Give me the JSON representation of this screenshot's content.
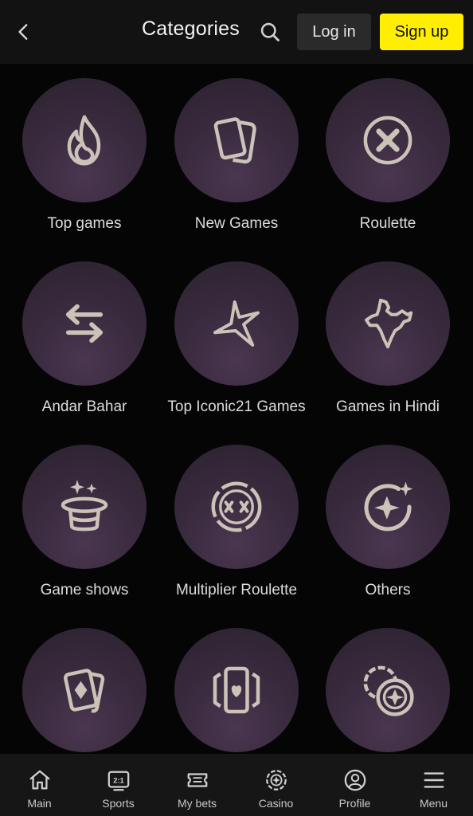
{
  "header": {
    "title": "Categories",
    "login_label": "Log in",
    "signup_label": "Sign up",
    "back_icon": "chevron-left-icon",
    "search_icon": "search-icon"
  },
  "colors": {
    "accent": "#ffee00",
    "circle_bg": "#3a2b3f",
    "icon": "#cbc3b7"
  },
  "categories": [
    {
      "label": "Top games",
      "icon": "flame-icon"
    },
    {
      "label": "New Games",
      "icon": "cards-icon"
    },
    {
      "label": "Roulette",
      "icon": "roulette-icon"
    },
    {
      "label": "Andar Bahar",
      "icon": "swap-arrows-icon"
    },
    {
      "label": "Top Iconic21 Games",
      "icon": "star-burst-icon"
    },
    {
      "label": "Games in Hindi",
      "icon": "india-map-icon"
    },
    {
      "label": "Game shows",
      "icon": "magic-hat-icon"
    },
    {
      "label": "Multiplier Roulette",
      "icon": "multiplier-wheel-icon"
    },
    {
      "label": "Others",
      "icon": "sparkle-circle-icon"
    },
    {
      "label": "",
      "icon": "diamond-cards-icon"
    },
    {
      "label": "",
      "icon": "heart-card-icon"
    },
    {
      "label": "",
      "icon": "chips-icon"
    }
  ],
  "bottom_nav": [
    {
      "label": "Main",
      "icon": "home-icon"
    },
    {
      "label": "Sports",
      "icon": "scoreboard-icon",
      "badge": "2:1"
    },
    {
      "label": "My bets",
      "icon": "ticket-icon"
    },
    {
      "label": "Casino",
      "icon": "casino-chip-icon"
    },
    {
      "label": "Profile",
      "icon": "profile-icon"
    },
    {
      "label": "Menu",
      "icon": "hamburger-icon"
    }
  ]
}
